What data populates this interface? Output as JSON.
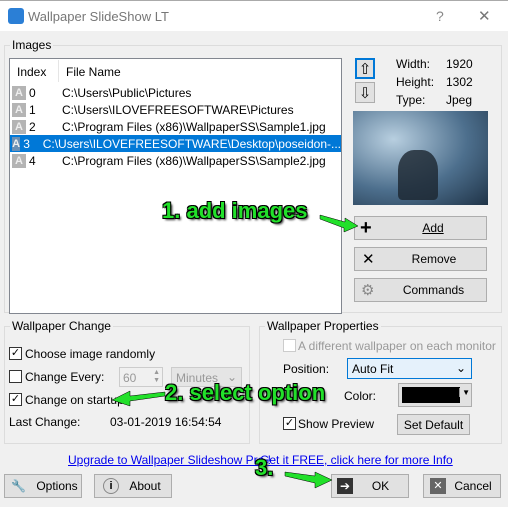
{
  "window": {
    "title": "Wallpaper SlideShow LT",
    "help": "?",
    "close": "✕"
  },
  "images": {
    "group_label": "Images",
    "columns": [
      "Index",
      "File Name"
    ],
    "rows": [
      {
        "index": "0",
        "file": "C:\\Users\\Public\\Pictures",
        "icon": "A"
      },
      {
        "index": "1",
        "file": "C:\\Users\\ILOVEFREESOFTWARE\\Pictures",
        "icon": "A"
      },
      {
        "index": "2",
        "file": "C:\\Program Files (x86)\\WallpaperSS\\Sample1.jpg",
        "icon": "A"
      },
      {
        "index": "3",
        "file": "C:\\Users\\ILOVEFREESOFTWARE\\Desktop\\poseidon-...",
        "icon": "A",
        "selected": true
      },
      {
        "index": "4",
        "file": "C:\\Program Files (x86)\\WallpaperSS\\Sample2.jpg",
        "icon": "A"
      }
    ],
    "info": {
      "width_label": "Width:",
      "width": "1920",
      "height_label": "Height:",
      "height": "1302",
      "type_label": "Type:",
      "type": "Jpeg"
    },
    "add": "Add",
    "remove": "Remove",
    "commands": "Commands"
  },
  "change": {
    "group_label": "Wallpaper Change",
    "random": "Choose image randomly",
    "random_checked": true,
    "every": "Change Every:",
    "every_checked": false,
    "every_value": "60",
    "every_unit": "Minutes",
    "startup": "Change on startup",
    "startup_checked": true,
    "last_label": "Last Change:",
    "last_value": "03-01-2019 16:54:54"
  },
  "props": {
    "group_label": "Wallpaper Properties",
    "monitor": "A different wallpaper on each monitor",
    "position_label": "Position:",
    "position_value": "Auto Fit",
    "color_label": "Color:",
    "color": "#000000",
    "preview": "Show Preview",
    "set_default": "Set Default"
  },
  "links": {
    "upgrade": "Upgrade to Wallpaper Slideshow Pro !",
    "free": "Get it FREE, click here for more Info"
  },
  "buttons": {
    "options": "Options",
    "about": "About",
    "ok": "OK",
    "cancel": "Cancel"
  },
  "annotations": {
    "a1": "1. add images",
    "a2": "2. select option",
    "a3": "3."
  },
  "colors": {
    "selection": "#0078d7",
    "annotation": "#22e02a"
  }
}
